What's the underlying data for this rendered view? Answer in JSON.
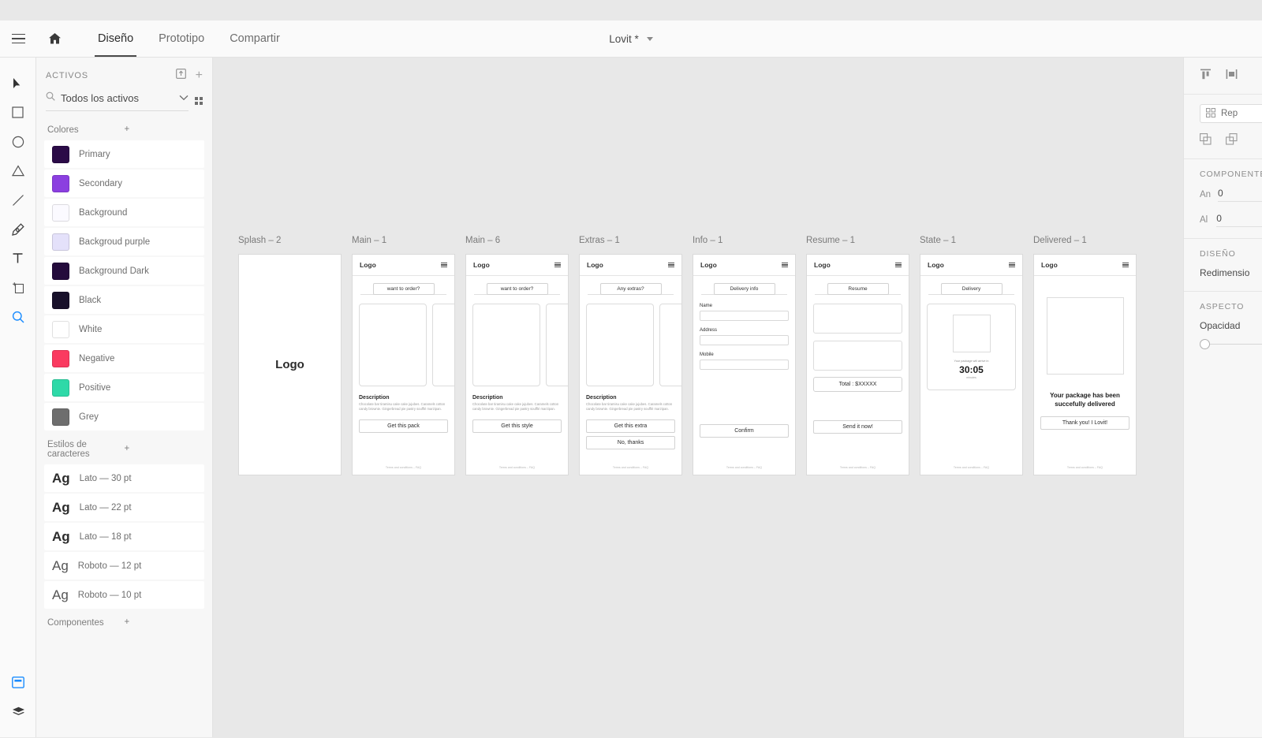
{
  "window": {
    "title": "Lovit *"
  },
  "menubar": {
    "hamburger_icon": "hamburger-menu-icon",
    "home_icon": "home-icon",
    "tabs": [
      {
        "label": "Diseño",
        "active": true
      },
      {
        "label": "Prototipo",
        "active": false
      },
      {
        "label": "Compartir",
        "active": false
      }
    ]
  },
  "toolbar": {
    "tools": [
      {
        "name": "select-tool",
        "icon": "cursor-arrow-icon"
      },
      {
        "name": "rectangle-tool",
        "icon": "rectangle-icon"
      },
      {
        "name": "ellipse-tool",
        "icon": "ellipse-icon"
      },
      {
        "name": "polygon-tool",
        "icon": "triangle-icon"
      },
      {
        "name": "line-tool",
        "icon": "line-icon"
      },
      {
        "name": "pen-tool",
        "icon": "pen-icon"
      },
      {
        "name": "text-tool",
        "icon": "text-t-icon"
      },
      {
        "name": "artboard-tool",
        "icon": "artboard-icon"
      },
      {
        "name": "zoom-tool",
        "icon": "magnifier-icon"
      }
    ],
    "bottom": [
      {
        "name": "assets-panel-toggle",
        "icon": "assets-panel-icon",
        "active": true
      },
      {
        "name": "layers-panel-toggle",
        "icon": "layers-stack-icon",
        "active": false
      }
    ]
  },
  "assets": {
    "title": "ACTIVOS",
    "export_icon": "export-icon",
    "add_icon": "plus-icon",
    "search": {
      "value": "Todos los activos",
      "placeholder": "Todos los activos",
      "icon": "search-icon",
      "chevron": "chevron-down-icon",
      "grid_icon": "grid-view-icon"
    },
    "colors_section": {
      "title": "Colores",
      "add_icon": "plus-icon"
    },
    "colors": [
      {
        "name": "Primary",
        "hex": "#2b0b47"
      },
      {
        "name": "Secondary",
        "hex": "#8b3fe0"
      },
      {
        "name": "Background",
        "hex": "#fbfaff"
      },
      {
        "name": "Backgroud purple",
        "hex": "#e4e1fa"
      },
      {
        "name": "Background Dark",
        "hex": "#240b3c"
      },
      {
        "name": "Black",
        "hex": "#18102a"
      },
      {
        "name": "White",
        "hex": "#ffffff"
      },
      {
        "name": "Negative",
        "hex": "#fa3a60"
      },
      {
        "name": "Positive",
        "hex": "#2ed9a8"
      },
      {
        "name": "Grey",
        "hex": "#6e6e6e"
      }
    ],
    "styles_section": {
      "title": "Estilos de caracteres",
      "add_icon": "plus-icon"
    },
    "character_styles": [
      {
        "sample": "Ag",
        "name": "Lato — 30 pt",
        "weight": "bold"
      },
      {
        "sample": "Ag",
        "name": "Lato — 22 pt",
        "weight": "bold"
      },
      {
        "sample": "Ag",
        "name": "Lato — 18 pt",
        "weight": "bold"
      },
      {
        "sample": "Ag",
        "name": "Roboto — 12 pt",
        "weight": "light"
      },
      {
        "sample": "Ag",
        "name": "Roboto — 10 pt",
        "weight": "light"
      }
    ],
    "components_section": {
      "title": "Componentes",
      "add_icon": "plus-icon"
    }
  },
  "canvas": {
    "common": {
      "logo": "Logo",
      "menu_icon": "hamburger-menu-icon",
      "description_title": "Description",
      "description_body": "Chocolate bar tiramisu cake cake jujubes. Caramels cotton candy brownie. Gingerbread pie pastry soufflé marzipan.",
      "footer": "Terms and conditions – FAQ"
    },
    "artboards": [
      {
        "id": "splash",
        "label": "Splash – 2",
        "type": "splash",
        "logo_text": "Logo"
      },
      {
        "id": "main1",
        "label": "Main – 1",
        "type": "catalog",
        "tab_label": "want to order?",
        "primary_button": "Get this pack"
      },
      {
        "id": "main6",
        "label": "Main – 6",
        "type": "catalog",
        "tab_label": "want to order?",
        "primary_button": "Get this style"
      },
      {
        "id": "extras",
        "label": "Extras – 1",
        "type": "catalog",
        "tab_label": "Any extras?",
        "primary_button": "Get this extra",
        "secondary_button": "No, thanks"
      },
      {
        "id": "info",
        "label": "Info – 1",
        "type": "form",
        "tab_label": "Delivery info",
        "fields": [
          {
            "label": "Name",
            "value": ""
          },
          {
            "label": "Address",
            "value": ""
          },
          {
            "label": "Mobile",
            "value": ""
          }
        ],
        "primary_button": "Confirm"
      },
      {
        "id": "resume",
        "label": "Resume – 1",
        "type": "resume",
        "tab_label": "Resume",
        "total": "Total : $XXXXX",
        "primary_button": "Send it now!"
      },
      {
        "id": "state",
        "label": "State – 1",
        "type": "state",
        "tab_label": "Delivery",
        "caption": "Your package will arrive in",
        "time": "30:05",
        "unit": "minutes"
      },
      {
        "id": "delivered",
        "label": "Delivered – 1",
        "type": "delivered",
        "message": "Your package has been succefully delivered",
        "primary_button": "Thank you! I Lovit!"
      }
    ]
  },
  "properties": {
    "align_icons": [
      "align-top-icon",
      "distribute-horizontal-icon"
    ],
    "repeat_grid_label": "Rep",
    "duplicate_icons": [
      "repeat-grid-icon",
      "duplicate-icon"
    ],
    "sections": [
      {
        "title": "COMPONENTE"
      },
      {
        "title": "DISEÑO"
      },
      {
        "title": "ASPECTO"
      }
    ],
    "width": {
      "label": "An",
      "value": "0"
    },
    "height": {
      "label": "Al",
      "value": "0"
    },
    "resize_label": "Redimensio",
    "opacity_label": "Opacidad"
  }
}
